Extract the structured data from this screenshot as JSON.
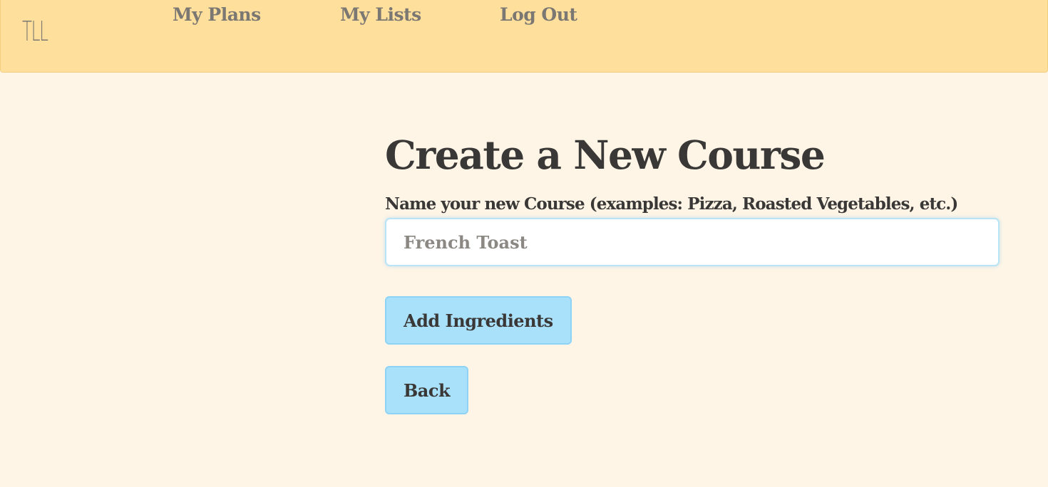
{
  "nav": {
    "brand": "TLL",
    "links": [
      {
        "label": "My Plans"
      },
      {
        "label": "My Lists"
      },
      {
        "label": "Log Out"
      }
    ]
  },
  "main": {
    "title": "Create a New Course",
    "name_label": "Name your new Course (examples: Pizza, Roasted Vegetables, etc.)",
    "name_placeholder": "French Toast",
    "name_value": "",
    "add_ingredients_label": "Add Ingredients",
    "back_label": "Back"
  },
  "colors": {
    "navbar_bg": "#ffdf9c",
    "page_bg": "#fef5e7",
    "button_bg": "#a9e1fb",
    "nav_text": "#7b7772",
    "body_text": "#3a3836"
  }
}
